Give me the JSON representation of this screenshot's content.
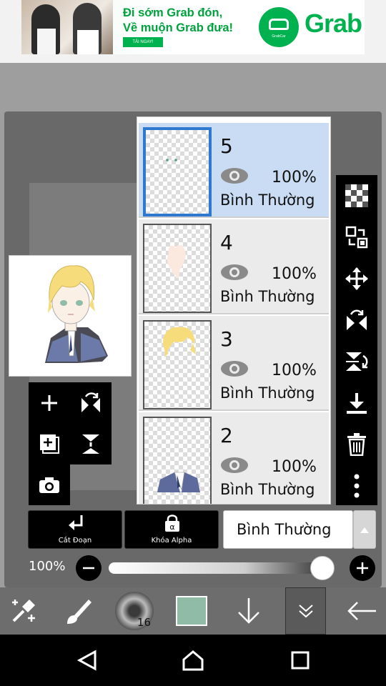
{
  "ad": {
    "headline_line1": "Đi sớm Grab đón,",
    "headline_line2": "Về muộn Grab đưa!",
    "cta": "TẢI NGAY!",
    "badge_caption": "GrabCar",
    "brand": "Grab",
    "brand_color": "#00b14f"
  },
  "layers": [
    {
      "number": "5",
      "opacity": "100%",
      "mode": "Bình Thường",
      "selected": true
    },
    {
      "number": "4",
      "opacity": "100%",
      "mode": "Bình Thường",
      "selected": false
    },
    {
      "number": "3",
      "opacity": "100%",
      "mode": "Bình Thường",
      "selected": false
    },
    {
      "number": "2",
      "opacity": "100%",
      "mode": "Bình Thường",
      "selected": false
    }
  ],
  "left_tools": [
    "plus-icon",
    "flip-layer-icon",
    "add-layer-icon",
    "merge-down-icon",
    "camera-icon"
  ],
  "right_tools": [
    "checkerboard-icon",
    "transfer-icon",
    "move-icon",
    "flip-horizontal-icon",
    "flip-vertical-icon",
    "download-icon",
    "trash-icon",
    "more-icon"
  ],
  "bottom_bar": {
    "clipping_label": "Cắt Đoạn",
    "alpha_lock_label": "Khóa Alpha",
    "blend_mode": "Bình Thường"
  },
  "opacity": {
    "label": "100%",
    "value": 1.0
  },
  "toolbar": {
    "brush_size": "16",
    "current_color": "#8fbba7",
    "accent_selected": "#2f78d0"
  },
  "navbar": [
    "back-icon",
    "home-icon",
    "recents-icon"
  ]
}
